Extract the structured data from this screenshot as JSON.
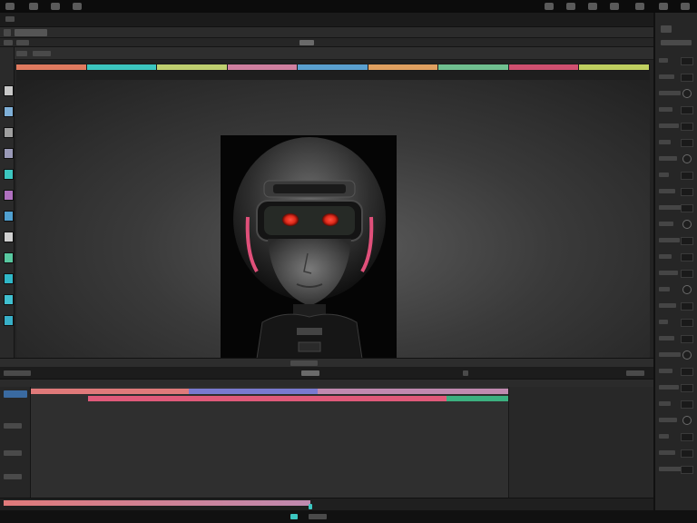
{
  "colors": {
    "panel_dark": "#1b1b1b",
    "panel": "#2b2b2b",
    "accent_red": "#e23a2a",
    "accent_pink": "#e0507a",
    "accent_teal": "#3cc6c0"
  },
  "left_swatches": [
    "#c8c8c8",
    "#7fb0d8",
    "#a0a0a0",
    "#9a9ab8",
    "#3cc6c0",
    "#b070c0",
    "#50a0d0",
    "#d0d0d0",
    "#58c8a0",
    "#30b8c8",
    "#40c0d0",
    "#38b0c8"
  ],
  "color_strip": [
    {
      "color": "#e07a5f"
    },
    {
      "color": "#3cc6c0"
    },
    {
      "color": "#c0d070"
    },
    {
      "color": "#d080a0"
    },
    {
      "color": "#5aa0d0"
    },
    {
      "color": "#e0a060"
    },
    {
      "color": "#70c090"
    },
    {
      "color": "#d05070"
    },
    {
      "color": "#c0d060"
    }
  ],
  "timeline_clips": [
    {
      "track": 0,
      "start": 0.0,
      "end": 0.33,
      "color": "#e07a7a"
    },
    {
      "track": 0,
      "start": 0.33,
      "end": 0.6,
      "color": "#7a7ad0"
    },
    {
      "track": 0,
      "start": 0.6,
      "end": 1.0,
      "color": "#c08ab0"
    },
    {
      "track": 1,
      "start": 0.12,
      "end": 0.87,
      "color": "#e05a7a"
    },
    {
      "track": 1,
      "start": 0.87,
      "end": 1.0,
      "color": "#3cb080"
    }
  ],
  "icons": {
    "play": "play-icon",
    "settings": "gear-icon",
    "dial": "dial-icon"
  }
}
